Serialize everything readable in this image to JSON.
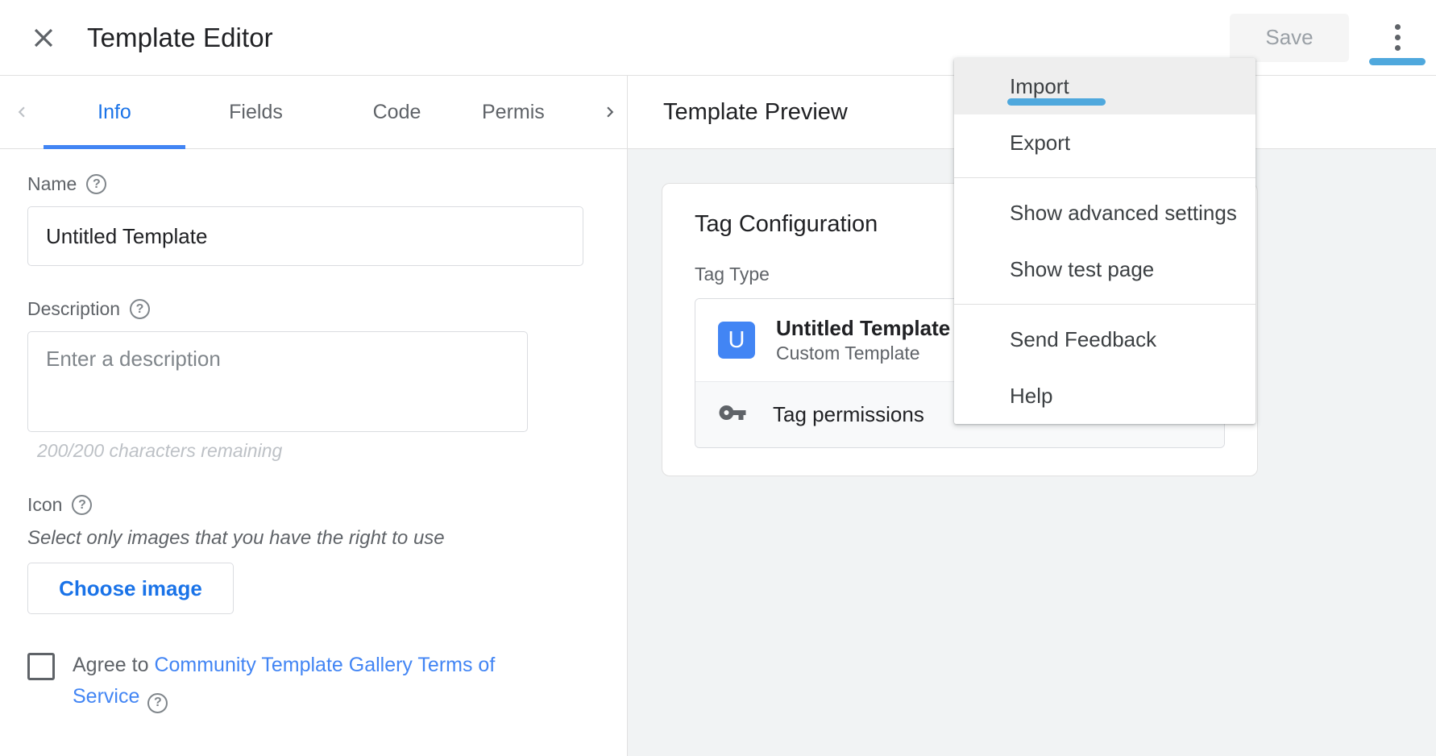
{
  "header": {
    "title": "Template Editor",
    "close_icon": "close-icon",
    "save_label": "Save",
    "overflow_icon": "more-vert-icon"
  },
  "tabs": {
    "prev_icon": "chevron-left-icon",
    "next_icon": "chevron-right-icon",
    "items": [
      {
        "label": "Info",
        "active": true
      },
      {
        "label": "Fields",
        "active": false
      },
      {
        "label": "Code",
        "active": false
      },
      {
        "label": "Permis",
        "active": false
      }
    ]
  },
  "form": {
    "name": {
      "label": "Name",
      "help_icon": "help-circle-icon",
      "value": "Untitled Template"
    },
    "description": {
      "label": "Description",
      "help_icon": "help-circle-icon",
      "value": "",
      "placeholder": "Enter a description",
      "counter": "200/200 characters remaining"
    },
    "icon": {
      "label": "Icon",
      "help_icon": "help-circle-icon",
      "note": "Select only images that you have the right to use",
      "choose_button": "Choose image"
    },
    "terms": {
      "checked": false,
      "prefix": "Agree to ",
      "link": "Community Template Gallery Terms of Service",
      "help_icon": "help-circle-icon"
    }
  },
  "preview": {
    "title": "Template Preview",
    "card": {
      "title": "Tag Configuration",
      "tag_type_label": "Tag Type",
      "tag_avatar_letter": "U",
      "tag_name": "Untitled Template",
      "tag_subtitle": "Custom Template",
      "permissions_icon": "key-icon",
      "permissions_label": "Tag permissions"
    }
  },
  "menu": {
    "items": [
      {
        "label": "Import",
        "highlighted": true
      },
      {
        "label": "Export",
        "highlighted": false
      },
      {
        "label": "Show advanced settings",
        "highlighted": false
      },
      {
        "label": "Show test page",
        "highlighted": false
      },
      {
        "label": "Send Feedback",
        "highlighted": false
      },
      {
        "label": "Help",
        "highlighted": false
      }
    ]
  },
  "colors": {
    "accent_blue": "#1a73e8",
    "tab_indicator": "#4285f4",
    "annotation": "#4fa8dd",
    "link": "#4285f4",
    "muted_text": "#5f6368"
  }
}
